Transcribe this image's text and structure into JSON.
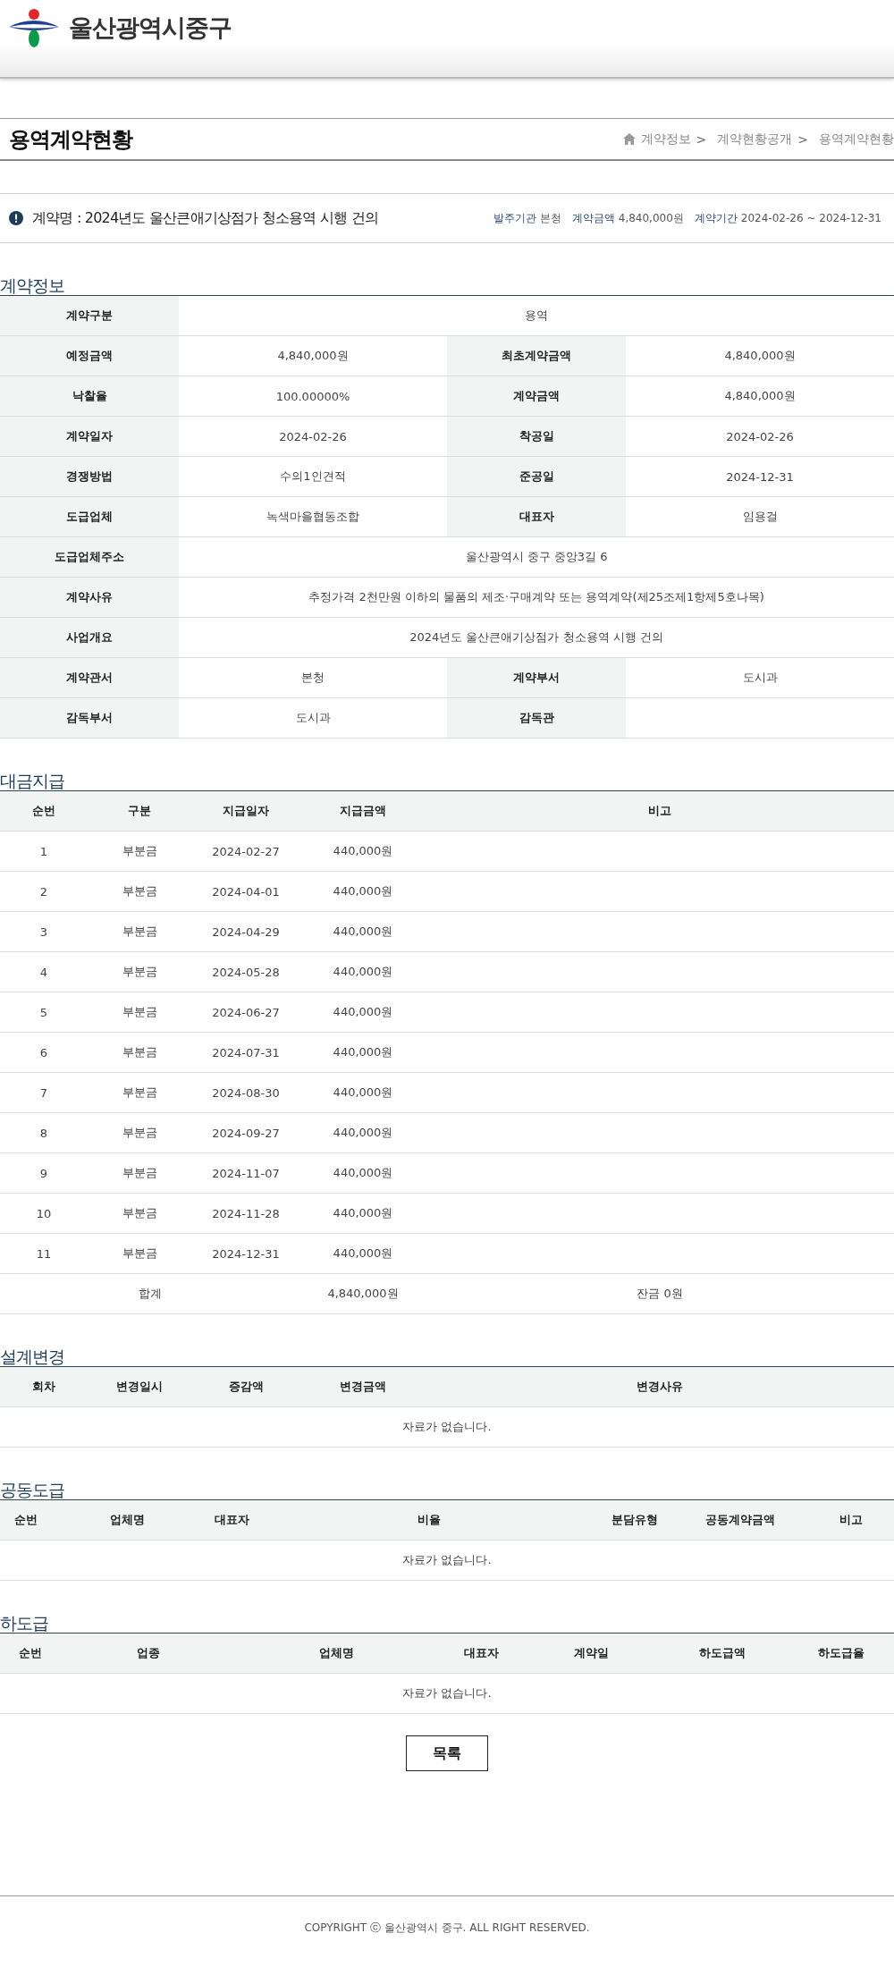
{
  "site": {
    "name": "울산광역시중구"
  },
  "page_title": "용역계약현황",
  "breadcrumb": {
    "items": [
      "계약정보",
      "계약현황공개",
      "용역계약현황"
    ],
    "separator": ">"
  },
  "contract_summary": {
    "title": "계약명 : 2024년도 울산큰애기상점가 청소용역 시행 건의",
    "facts": [
      {
        "label": "발주기관",
        "value": "본청"
      },
      {
        "label": "계약금액",
        "value": "4,840,000원"
      },
      {
        "label": "계약기간",
        "value": "2024-02-26 ~ 2024-12-31"
      }
    ]
  },
  "contract_info": {
    "title": "계약정보",
    "rows": [
      [
        {
          "label": "계약구분",
          "value": "용역"
        }
      ],
      [
        {
          "label": "예정금액",
          "value": "4,840,000원"
        },
        {
          "label": "최초계약금액",
          "value": "4,840,000원"
        }
      ],
      [
        {
          "label": "낙찰율",
          "value": "100.00000%"
        },
        {
          "label": "계약금액",
          "value": "4,840,000원"
        }
      ],
      [
        {
          "label": "계약일자",
          "value": "2024-02-26"
        },
        {
          "label": "착공일",
          "value": "2024-02-26"
        }
      ],
      [
        {
          "label": "경쟁방법",
          "value": "수의1인견적"
        },
        {
          "label": "준공일",
          "value": "2024-12-31"
        }
      ],
      [
        {
          "label": "도급업체",
          "value": "녹색마을협동조합"
        },
        {
          "label": "대표자",
          "value": "임용걸"
        }
      ],
      [
        {
          "label": "도급업체주소",
          "value": "울산광역시 중구 중앙3길 6"
        }
      ],
      [
        {
          "label": "계약사유",
          "value": "추정가격 2천만원 이하의 물품의 제조·구매계약 또는 용역계약(제25조제1항제5호나목)"
        }
      ],
      [
        {
          "label": "사업개요",
          "value": "2024년도 울산큰애기상점가 청소용역 시행 건의"
        }
      ],
      [
        {
          "label": "계약관서",
          "value": "본청"
        },
        {
          "label": "계약부서",
          "value": "도시과"
        }
      ],
      [
        {
          "label": "감독부서",
          "value": "도시과"
        },
        {
          "label": "감독관"
        }
      ]
    ]
  },
  "payments": {
    "title": "대금지급",
    "columns": [
      "순번",
      "구분",
      "지급일자",
      "지급금액",
      "비고"
    ],
    "rows": [
      [
        "1",
        "부분금",
        "2024-02-27",
        "440,000원"
      ],
      [
        "2",
        "부분금",
        "2024-04-01",
        "440,000원"
      ],
      [
        "3",
        "부분금",
        "2024-04-29",
        "440,000원"
      ],
      [
        "4",
        "부분금",
        "2024-05-28",
        "440,000원"
      ],
      [
        "5",
        "부분금",
        "2024-06-27",
        "440,000원"
      ],
      [
        "6",
        "부분금",
        "2024-07-31",
        "440,000원"
      ],
      [
        "7",
        "부분금",
        "2024-08-30",
        "440,000원"
      ],
      [
        "8",
        "부분금",
        "2024-09-27",
        "440,000원"
      ],
      [
        "9",
        "부분금",
        "2024-11-07",
        "440,000원"
      ],
      [
        "10",
        "부분금",
        "2024-11-28",
        "440,000원"
      ],
      [
        "11",
        "부분금",
        "2024-12-31",
        "440,000원"
      ]
    ],
    "total": {
      "label": "합계",
      "amount": "4,840,000원",
      "balance": "잔금 0원"
    }
  },
  "design_changes": {
    "title": "설계변경",
    "columns": [
      "회차",
      "변경일시",
      "증감액",
      "변경금액",
      "변경사유"
    ],
    "empty_message": "자료가 없습니다."
  },
  "joint_contracts": {
    "title": "공동도급",
    "columns": [
      "순번",
      "업체명",
      "대표자",
      "비율",
      "분담유형",
      "공동계약금액",
      "비고"
    ],
    "empty_message": "자료가 없습니다."
  },
  "subcontracts": {
    "title": "하도급",
    "columns": [
      "순번",
      "업종",
      "업체명",
      "대표자",
      "계약일",
      "하도급액",
      "하도급율"
    ],
    "empty_message": "자료가 없습니다."
  },
  "list_button": "목록",
  "footer": "COPYRIGHT ⓒ 울산광역시 중구. ALL RIGHT RESERVED."
}
